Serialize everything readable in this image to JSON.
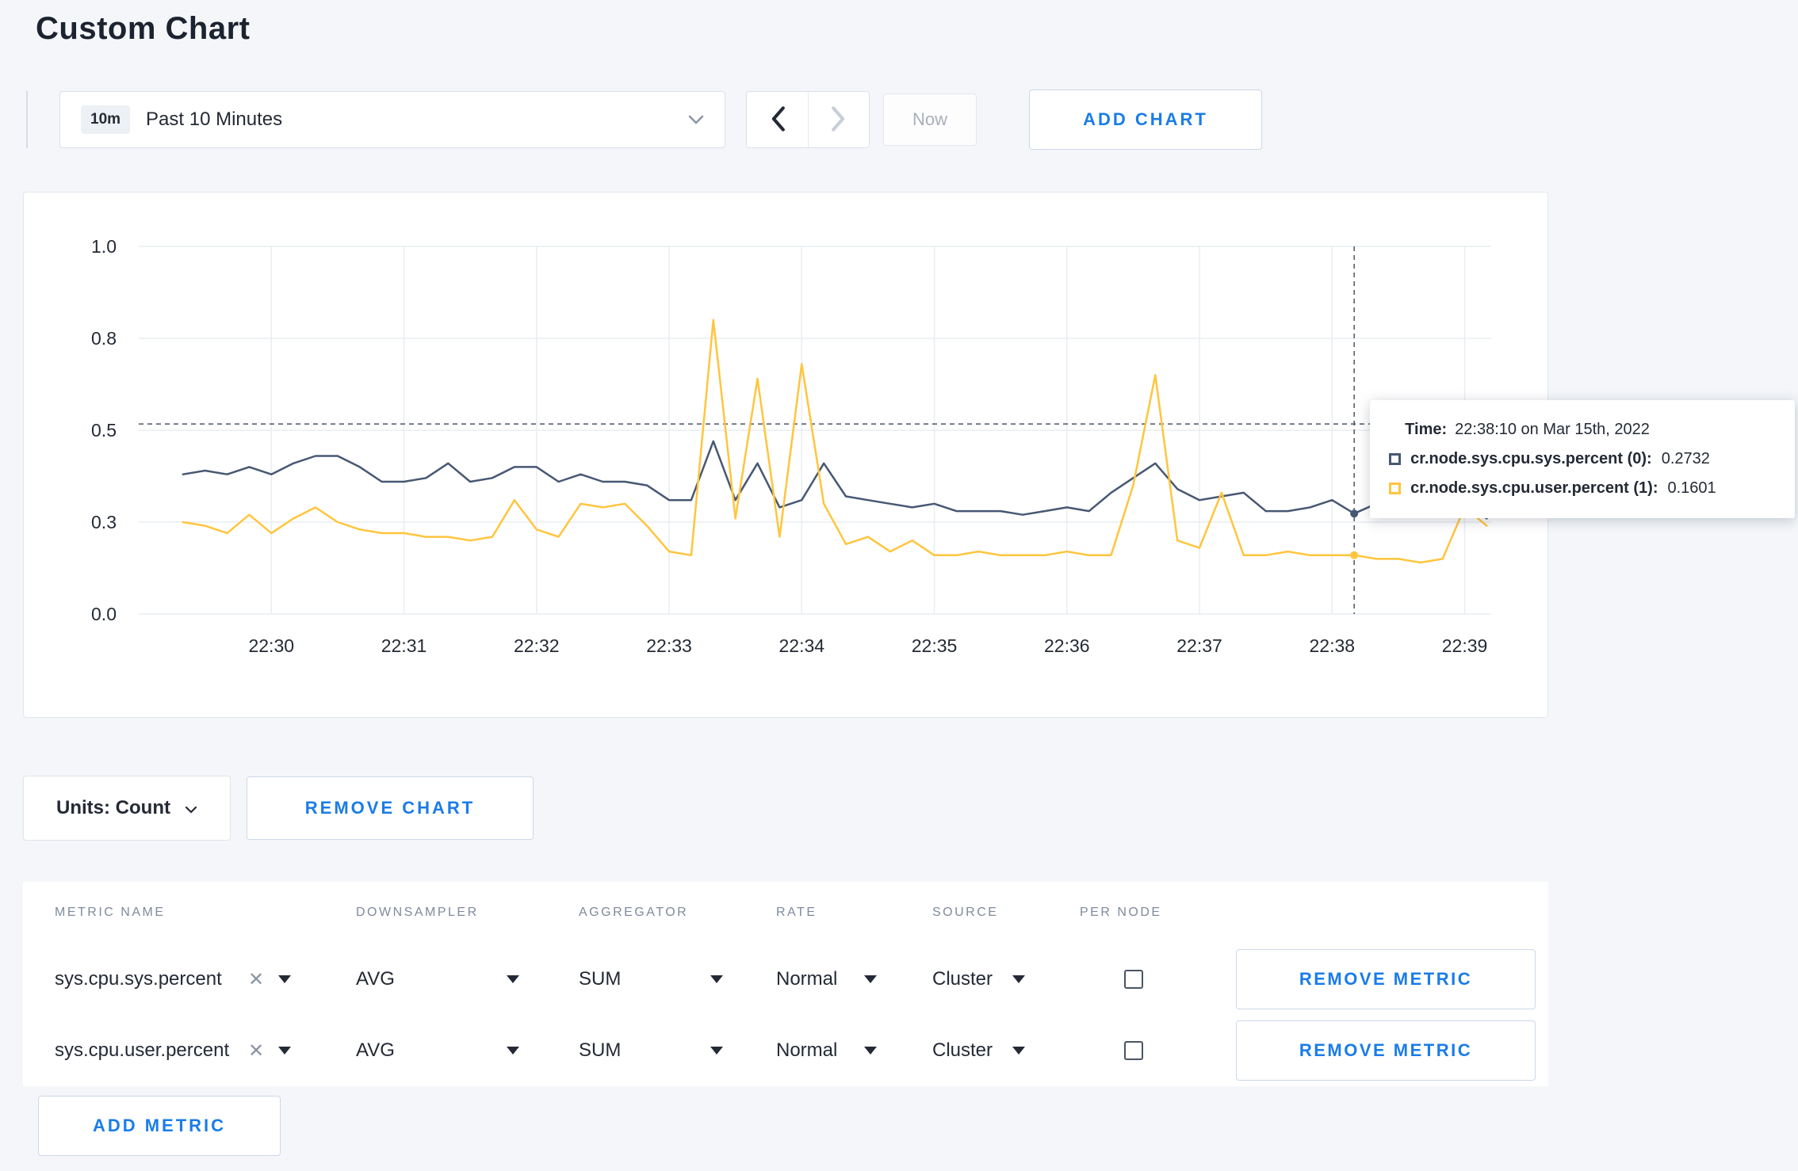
{
  "page": {
    "title": "Custom Chart"
  },
  "colors": {
    "accent": "#1a7ce8",
    "page_bg": "#f4f6f9",
    "card_bg": "#ffffff",
    "grid_line": "#e9edf2",
    "series_sys": "#475872",
    "series_user": "#ffc53d"
  },
  "icons": {
    "clear": "✕"
  },
  "toolbar": {
    "timescale": {
      "badge": "10m",
      "label": "Past 10 Minutes"
    },
    "now_label": "Now",
    "add_chart_label": "ADD CHART"
  },
  "tooltip": {
    "time_label": "Time:",
    "time_value": "22:38:10 on Mar 15th, 2022",
    "rows": [
      {
        "label": "cr.node.sys.cpu.sys.percent (0):",
        "value": "0.2732"
      },
      {
        "label": "cr.node.sys.cpu.user.percent (1):",
        "value": "0.1601"
      }
    ]
  },
  "chart_controls": {
    "units_label": "Units: Count",
    "remove_chart_label": "REMOVE CHART",
    "add_metric_label": "ADD METRIC"
  },
  "table": {
    "headers": [
      "METRIC NAME",
      "DOWNSAMPLER",
      "AGGREGATOR",
      "RATE",
      "SOURCE",
      "PER NODE"
    ],
    "rows": [
      {
        "metric": "sys.cpu.sys.percent",
        "downsampler": "AVG",
        "aggregator": "SUM",
        "rate": "Normal",
        "source": "Cluster",
        "per_node": false,
        "remove_label": "REMOVE METRIC"
      },
      {
        "metric": "sys.cpu.user.percent",
        "downsampler": "AVG",
        "aggregator": "SUM",
        "rate": "Normal",
        "source": "Cluster",
        "per_node": false,
        "remove_label": "REMOVE METRIC"
      }
    ]
  },
  "chart_data": {
    "type": "line",
    "title": "",
    "grid": true,
    "x_axis": {
      "base_time": "22:29:00",
      "domain_seconds": [
        0,
        612
      ],
      "ticks": [
        {
          "t": 60,
          "label": "22:30"
        },
        {
          "t": 120,
          "label": "22:31"
        },
        {
          "t": 180,
          "label": "22:32"
        },
        {
          "t": 240,
          "label": "22:33"
        },
        {
          "t": 300,
          "label": "22:34"
        },
        {
          "t": 360,
          "label": "22:35"
        },
        {
          "t": 420,
          "label": "22:36"
        },
        {
          "t": 480,
          "label": "22:37"
        },
        {
          "t": 540,
          "label": "22:38"
        },
        {
          "t": 600,
          "label": "22:39"
        }
      ]
    },
    "y_axis": {
      "lim": [
        0,
        1
      ],
      "ticks": [
        {
          "v": 0.0,
          "label": "0.0"
        },
        {
          "v": 0.25,
          "label": "0.3"
        },
        {
          "v": 0.5,
          "label": "0.5"
        },
        {
          "v": 0.75,
          "label": "0.8"
        },
        {
          "v": 1.0,
          "label": "1.0"
        }
      ]
    },
    "crosshair": {
      "t": 550,
      "time_label": "22:38:10",
      "hline_v": 0.517
    },
    "series": [
      {
        "name": "cr.node.sys.cpu.sys.percent",
        "color": "#475872",
        "start": 20,
        "step": 10,
        "values": [
          0.38,
          0.39,
          0.38,
          0.4,
          0.38,
          0.41,
          0.43,
          0.43,
          0.4,
          0.36,
          0.36,
          0.37,
          0.41,
          0.36,
          0.37,
          0.4,
          0.4,
          0.36,
          0.38,
          0.36,
          0.36,
          0.35,
          0.31,
          0.31,
          0.47,
          0.31,
          0.41,
          0.29,
          0.31,
          0.41,
          0.32,
          0.31,
          0.3,
          0.29,
          0.3,
          0.28,
          0.28,
          0.28,
          0.27,
          0.28,
          0.29,
          0.28,
          0.33,
          0.37,
          0.41,
          0.34,
          0.31,
          0.32,
          0.33,
          0.28,
          0.28,
          0.29,
          0.31,
          0.2732,
          0.3,
          0.31,
          0.29,
          0.31,
          0.3,
          0.26
        ]
      },
      {
        "name": "cr.node.sys.cpu.user.percent",
        "color": "#ffc53d",
        "start": 20,
        "step": 10,
        "values": [
          0.25,
          0.24,
          0.22,
          0.27,
          0.22,
          0.26,
          0.29,
          0.25,
          0.23,
          0.22,
          0.22,
          0.21,
          0.21,
          0.2,
          0.21,
          0.31,
          0.23,
          0.21,
          0.3,
          0.29,
          0.3,
          0.24,
          0.17,
          0.16,
          0.8,
          0.26,
          0.64,
          0.21,
          0.68,
          0.3,
          0.19,
          0.21,
          0.17,
          0.2,
          0.16,
          0.16,
          0.17,
          0.16,
          0.16,
          0.16,
          0.17,
          0.16,
          0.16,
          0.35,
          0.65,
          0.2,
          0.18,
          0.33,
          0.16,
          0.16,
          0.17,
          0.16,
          0.16,
          0.1601,
          0.15,
          0.15,
          0.14,
          0.15,
          0.29,
          0.24
        ]
      }
    ]
  }
}
